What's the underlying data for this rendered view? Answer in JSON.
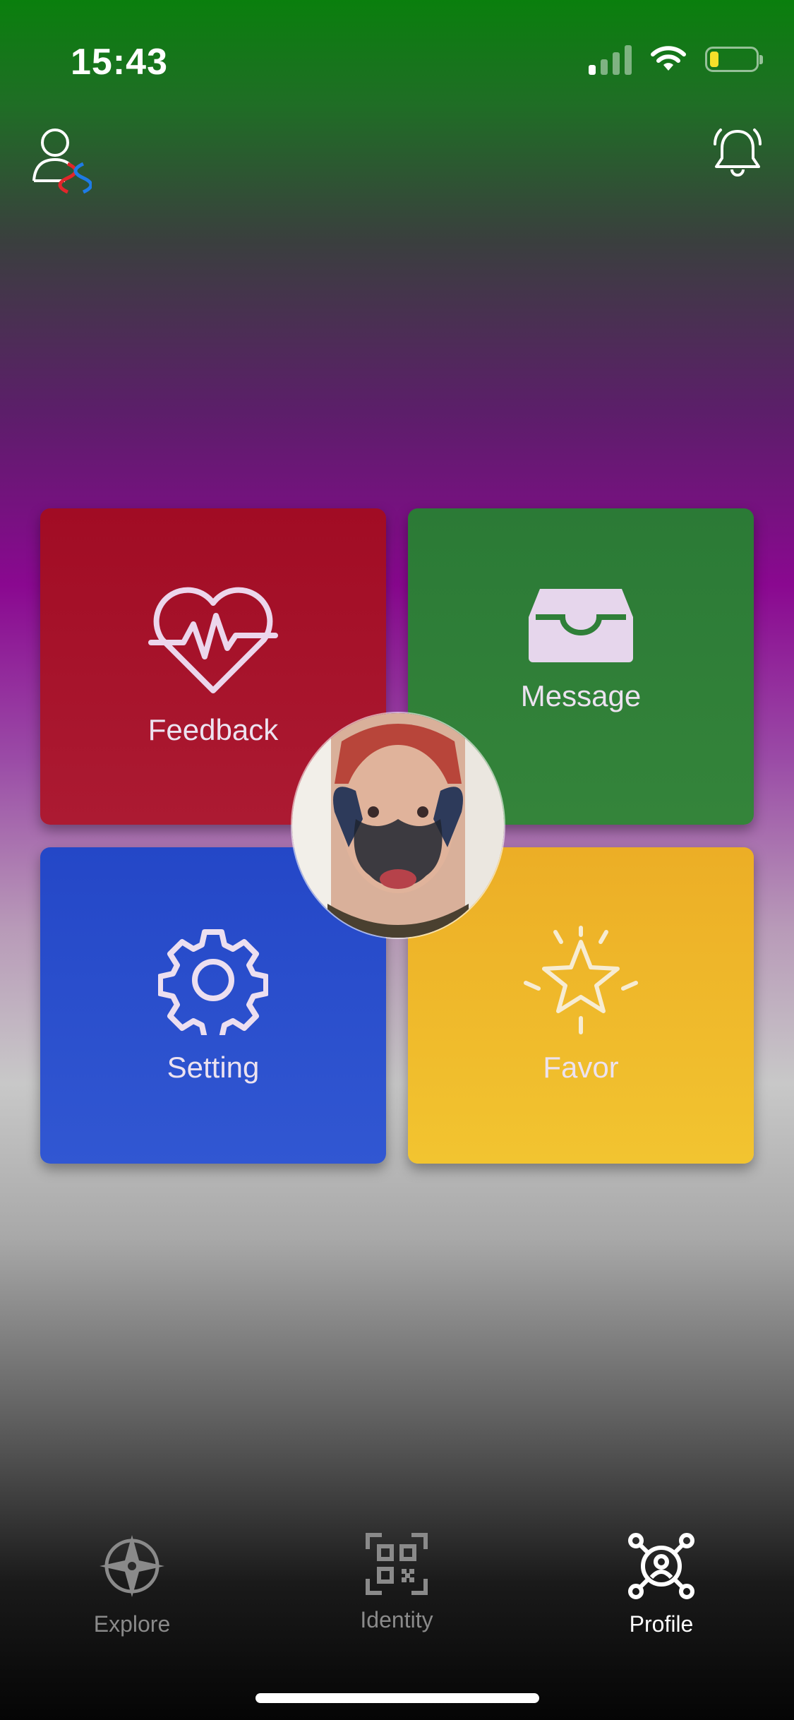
{
  "status": {
    "time": "15:43"
  },
  "cards": {
    "feedback": {
      "label": "Feedback"
    },
    "message": {
      "label": "Message"
    },
    "setting": {
      "label": "Setting"
    },
    "favor": {
      "label": "Favor"
    }
  },
  "tabs": [
    {
      "label": "Explore",
      "icon": "compass-icon",
      "active": false
    },
    {
      "label": "Identity",
      "icon": "qr-code-icon",
      "active": false
    },
    {
      "label": "Profile",
      "icon": "profile-network-icon",
      "active": true
    }
  ],
  "colors": {
    "feedback": "#a8142d",
    "message": "#2f7f38",
    "setting": "#2b4fcd",
    "favor": "#f0b82b",
    "tab_inactive": "#8a8a8a",
    "tab_active": "#ffffff"
  }
}
